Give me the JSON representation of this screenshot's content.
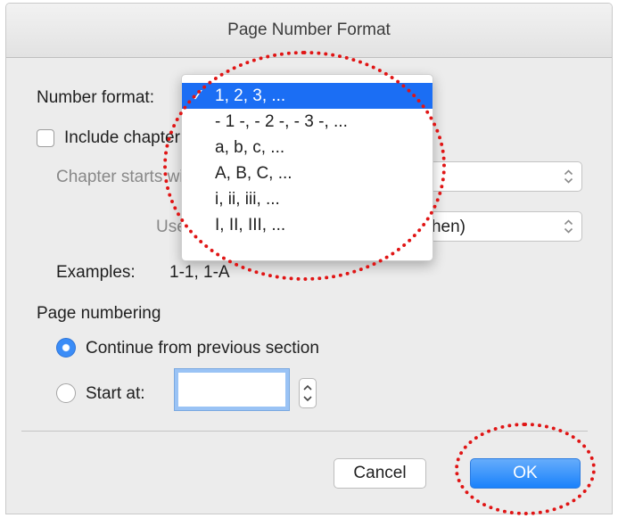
{
  "dialog": {
    "title": "Page Number Format",
    "number_format_label": "Number format:",
    "include_chapter_label": "Include chapter number",
    "chapter_starts_label": "Chapter starts with style",
    "use_separator_label": "Use separator:",
    "use_separator_value": "(hyphen)",
    "examples_label": "Examples:",
    "examples_value": "1-1, 1-A",
    "page_numbering_label": "Page numbering",
    "continue_label": "Continue from previous section",
    "start_at_label": "Start at:",
    "start_at_value": "",
    "cancel_label": "Cancel",
    "ok_label": "OK"
  },
  "number_format_menu": {
    "checkmark": "✓",
    "items": [
      "1, 2, 3, ...",
      "- 1 -, - 2 -, - 3 -, ...",
      "a, b, c, ...",
      "A, B, C, ...",
      "i, ii, iii, ...",
      "I, II, III, ..."
    ],
    "selected_index": 0
  },
  "state": {
    "include_chapter_checked": false,
    "page_numbering": "continue"
  },
  "colors": {
    "accent": "#1b6ef4",
    "annotation": "#e01515",
    "ok_button": "#1a82fb"
  },
  "icons": [
    "checkmark-icon",
    "chevron-up-down-icon",
    "stepper-icon"
  ]
}
